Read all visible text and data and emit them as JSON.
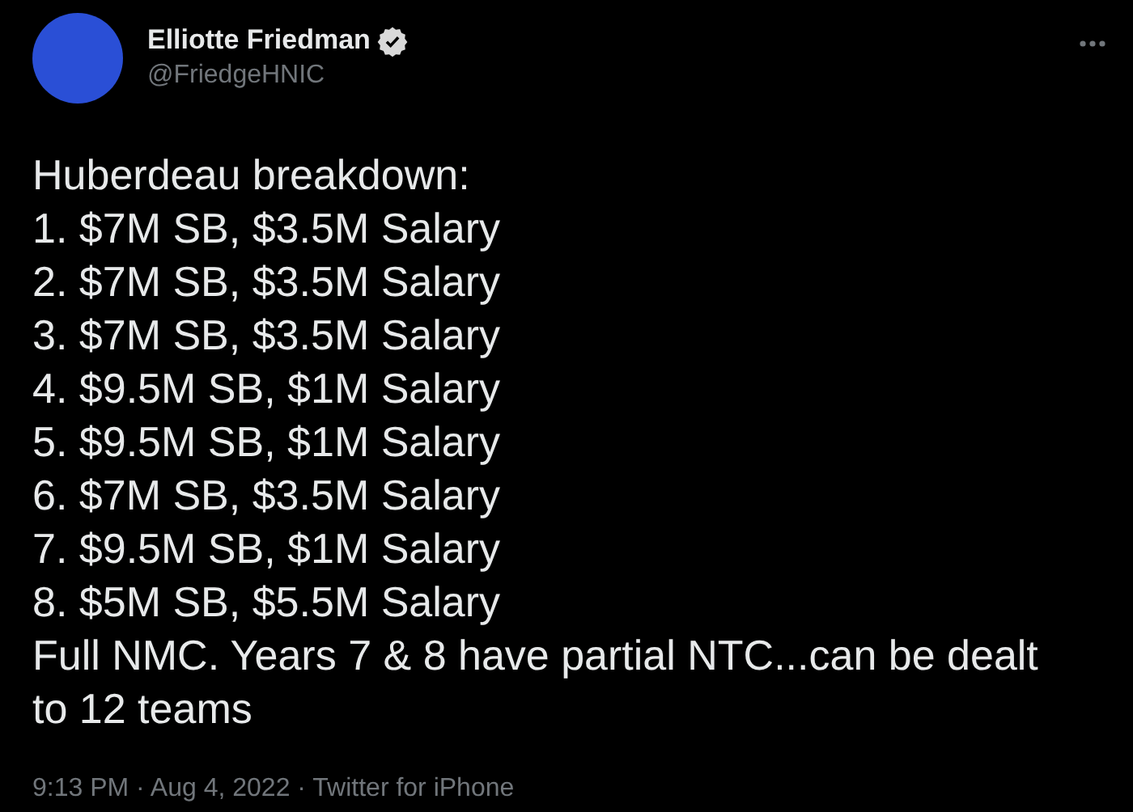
{
  "author": {
    "name": "Elliotte Friedman",
    "handle": "@FriedgeHNIC",
    "verified": true
  },
  "tweet": {
    "lines": [
      "Huberdeau breakdown:",
      "1. $7M SB, $3.5M Salary",
      "2. $7M SB, $3.5M Salary",
      "3. $7M SB, $3.5M Salary",
      "4. $9.5M SB, $1M Salary",
      "5. $9.5M SB, $1M Salary",
      "6. $7M SB, $3.5M Salary",
      "7. $9.5M SB, $1M Salary",
      "8. $5M SB, $5.5M Salary",
      "Full NMC. Years 7 & 8 have partial NTC...can be dealt to 12 teams"
    ]
  },
  "meta": "9:13 PM · Aug 4, 2022 · Twitter for iPhone"
}
